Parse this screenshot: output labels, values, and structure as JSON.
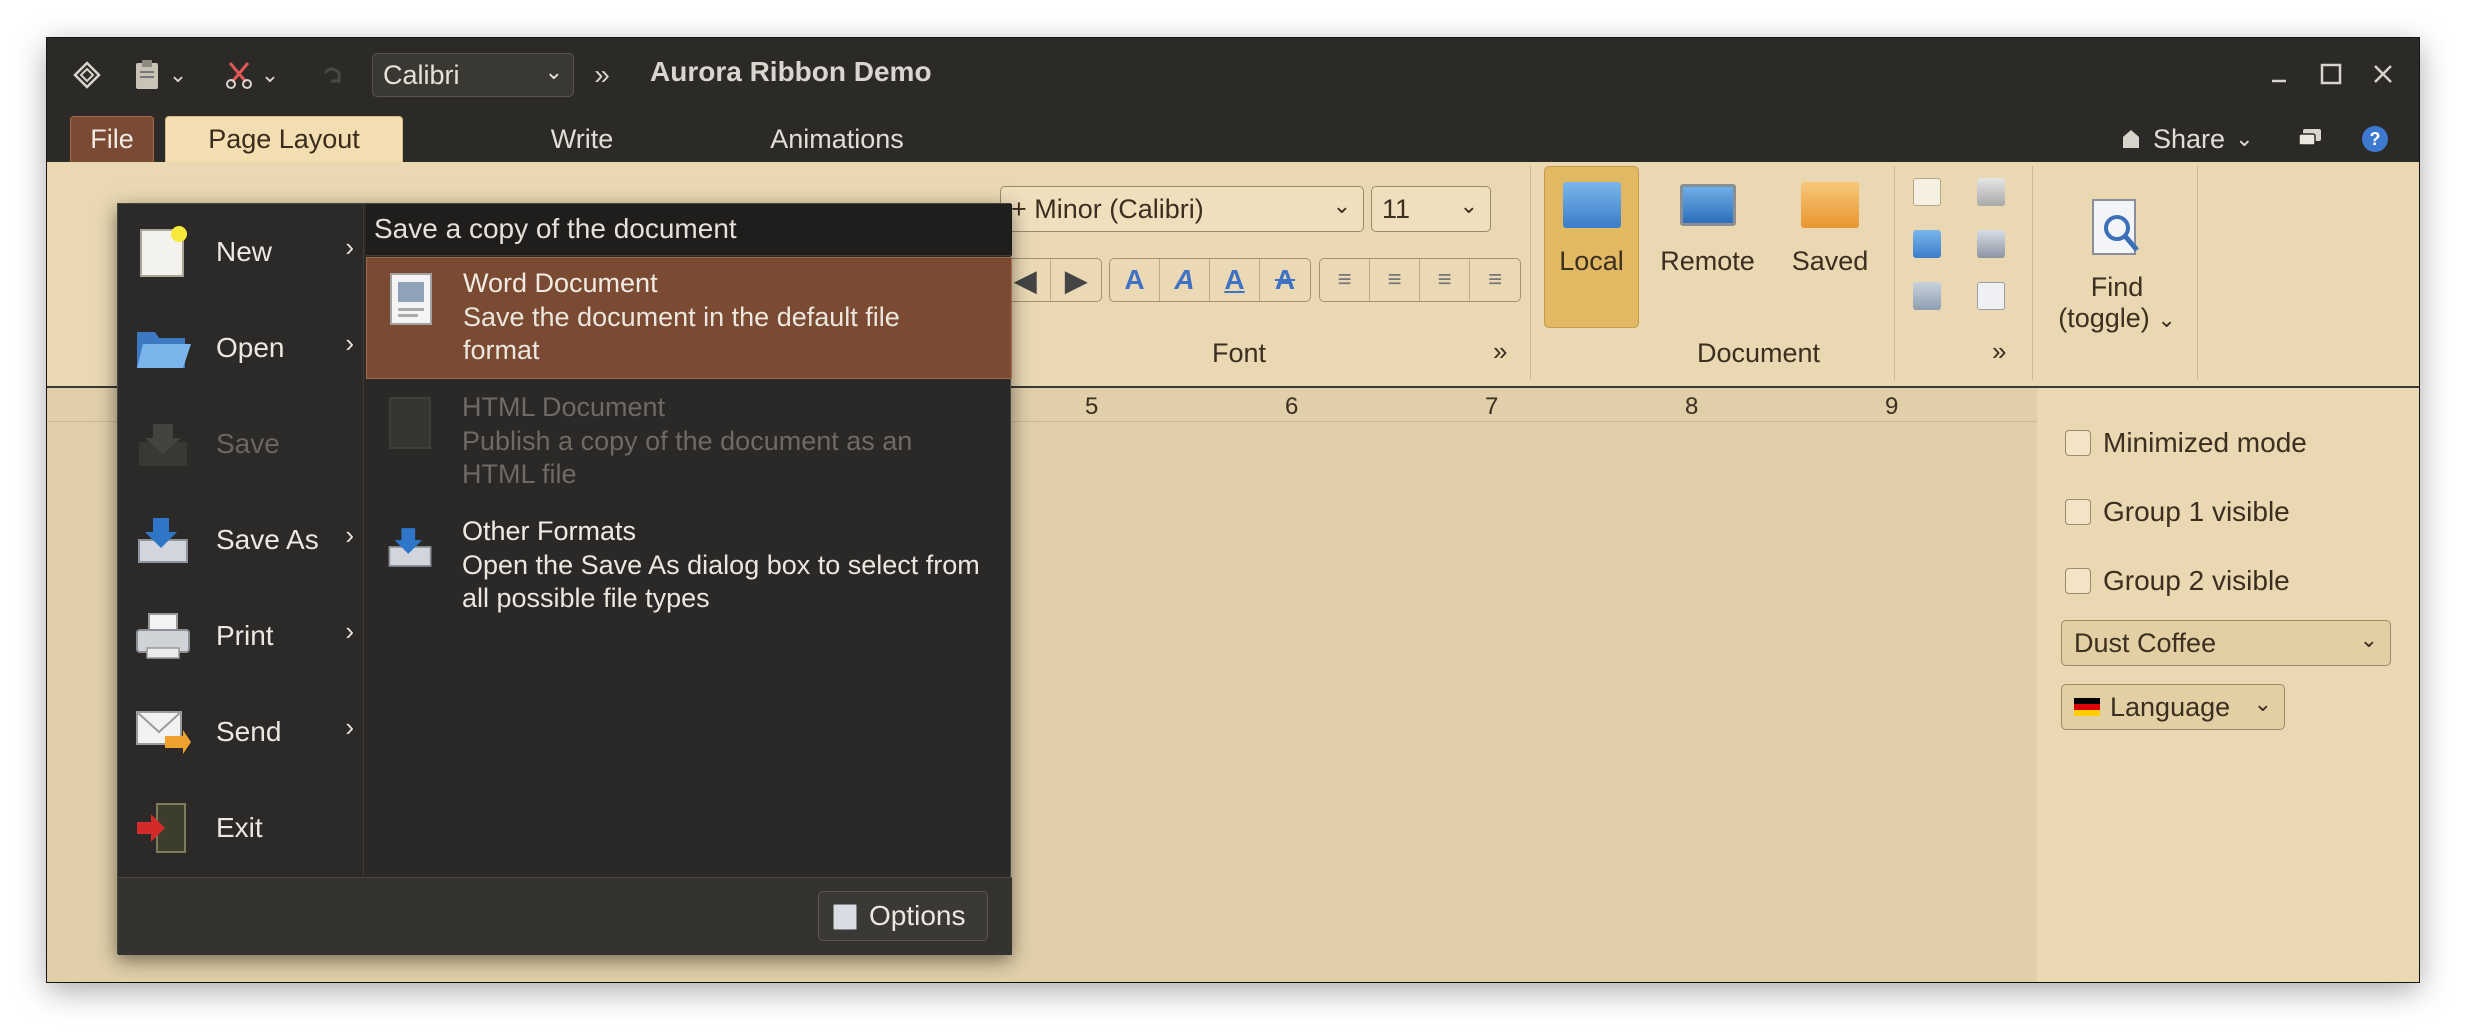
{
  "window": {
    "title": "Aurora Ribbon Demo"
  },
  "quick_access": {
    "font_name": "Calibri"
  },
  "tabs": [
    {
      "label": "File",
      "active": false
    },
    {
      "label": "Page Layout",
      "active": true
    },
    {
      "label": "Write",
      "active": false
    },
    {
      "label": "Animations",
      "active": false
    }
  ],
  "share": {
    "label": "Share"
  },
  "ribbon": {
    "font_group": {
      "font_family": "+ Minor (Calibri)",
      "font_size": "11",
      "label": "Font"
    },
    "document_group": {
      "label": "Document",
      "buttons": [
        {
          "label": "Local",
          "selected": true
        },
        {
          "label": "Remote",
          "selected": false
        },
        {
          "label": "Saved",
          "selected": false
        }
      ]
    },
    "find": {
      "label_line1": "Find",
      "label_line2": "(toggle)"
    }
  },
  "ruler": {
    "numbers": [
      "5",
      "6",
      "7",
      "8",
      "9"
    ]
  },
  "side_panel": {
    "checkboxes": [
      {
        "label": "Minimized mode",
        "checked": false
      },
      {
        "label": "Group 1 visible",
        "checked": false
      },
      {
        "label": "Group 2 visible",
        "checked": false
      }
    ],
    "skin_combo": "Dust Coffee",
    "language_combo": "Language"
  },
  "file_menu": {
    "items": [
      {
        "label": "New",
        "has_submenu": true,
        "enabled": true,
        "icon": "new-document-icon"
      },
      {
        "label": "Open",
        "has_submenu": true,
        "enabled": true,
        "icon": "open-folder-icon"
      },
      {
        "label": "Save",
        "has_submenu": false,
        "enabled": false,
        "icon": "save-icon"
      },
      {
        "label": "Save As",
        "has_submenu": true,
        "enabled": true,
        "icon": "save-as-icon"
      },
      {
        "label": "Print",
        "has_submenu": true,
        "enabled": true,
        "icon": "printer-icon"
      },
      {
        "label": "Send",
        "has_submenu": true,
        "enabled": true,
        "icon": "send-mail-icon"
      },
      {
        "label": "Exit",
        "has_submenu": false,
        "enabled": true,
        "icon": "exit-icon"
      }
    ],
    "panel_heading": "Save a copy of the document",
    "panel_options": [
      {
        "title": "Word Document",
        "description": "Save the document in the default file format",
        "selected": true,
        "enabled": true
      },
      {
        "title": "HTML Document",
        "description": "Publish a copy of the document as an HTML file",
        "selected": false,
        "enabled": false
      },
      {
        "title": "Other Formats",
        "description": "Open the Save As dialog box to select from all possible file types",
        "selected": false,
        "enabled": true
      }
    ],
    "options_button": "Options"
  },
  "colors": {
    "title_bar": "#2b2a27",
    "ribbon_bg": "#e9d8b2",
    "accent_tab": "#7a4a35",
    "selected_item": "#7a4a33",
    "local_selected": "#e2b963"
  }
}
